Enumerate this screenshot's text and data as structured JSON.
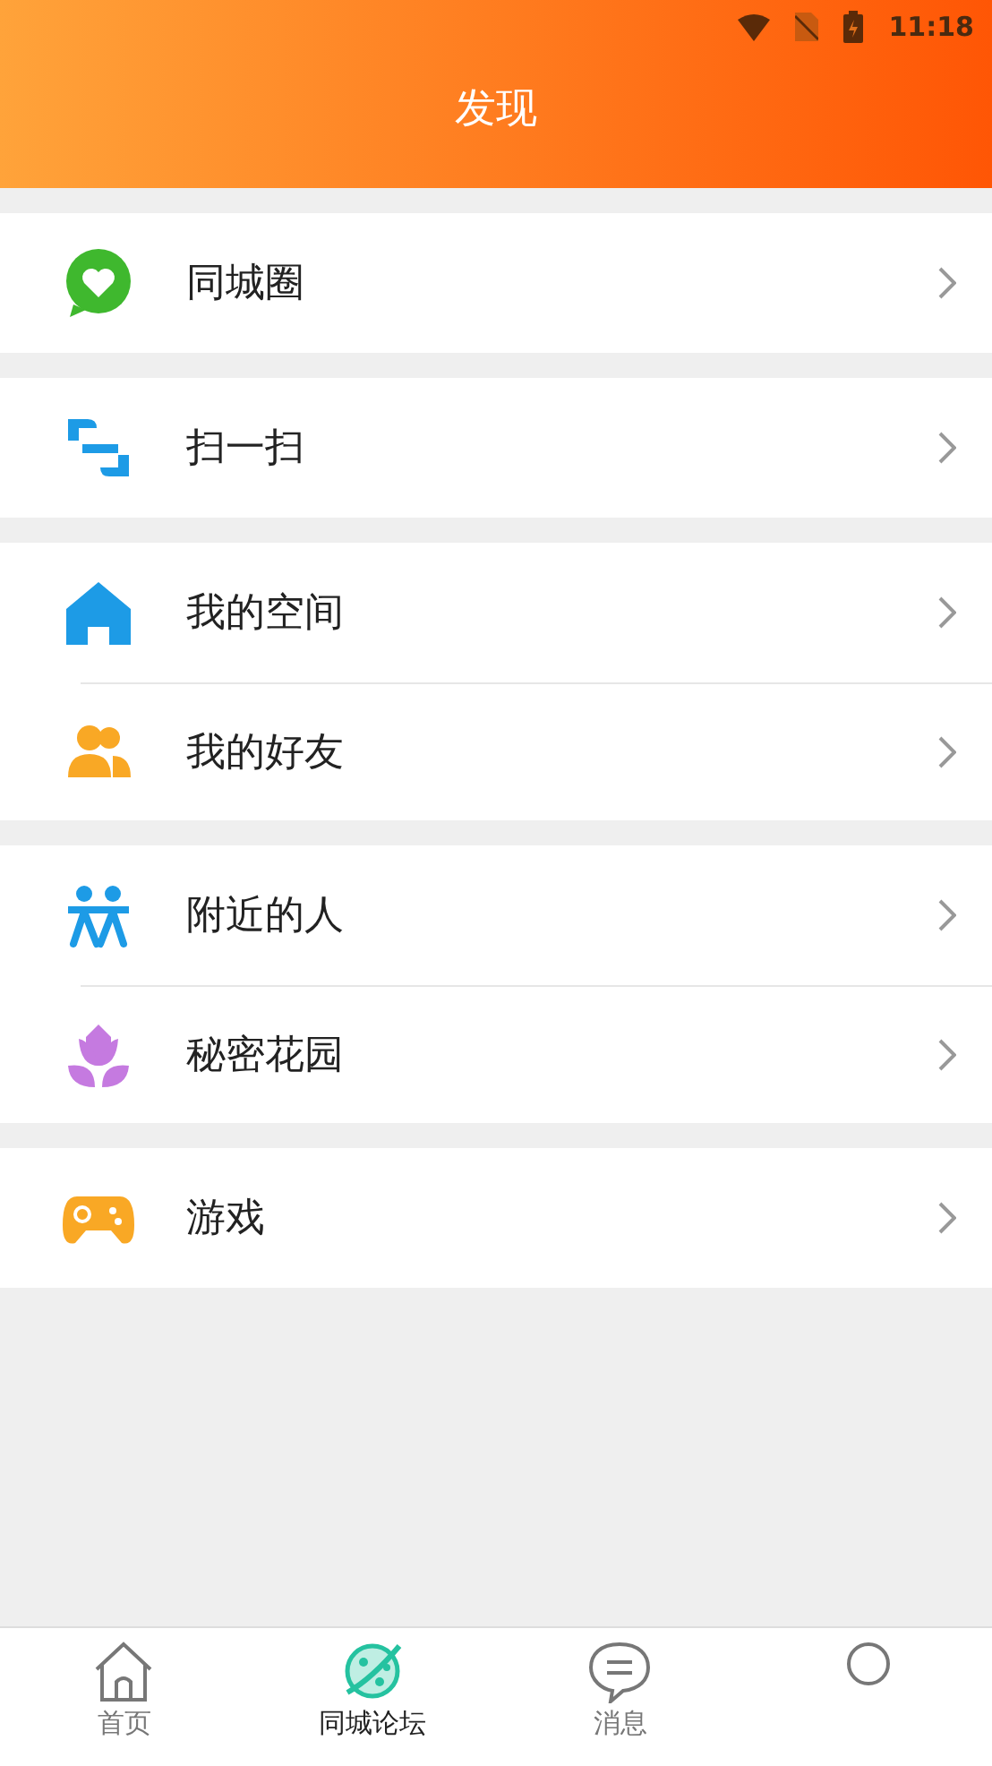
{
  "status_bar": {
    "time": "11:18"
  },
  "header": {
    "title": "发现"
  },
  "groups": [
    {
      "items": [
        {
          "label": "同城圈"
        }
      ]
    },
    {
      "items": [
        {
          "label": "扫一扫"
        }
      ]
    },
    {
      "items": [
        {
          "label": "我的空间"
        },
        {
          "label": "我的好友"
        }
      ]
    },
    {
      "items": [
        {
          "label": "附近的人"
        },
        {
          "label": "秘密花园"
        }
      ]
    },
    {
      "items": [
        {
          "label": "游戏"
        }
      ]
    }
  ],
  "tabs": [
    {
      "label": "首页",
      "selected": false
    },
    {
      "label": "同城论坛",
      "selected": true
    },
    {
      "label": "消息",
      "selected": false
    },
    {
      "selected": false
    }
  ]
}
